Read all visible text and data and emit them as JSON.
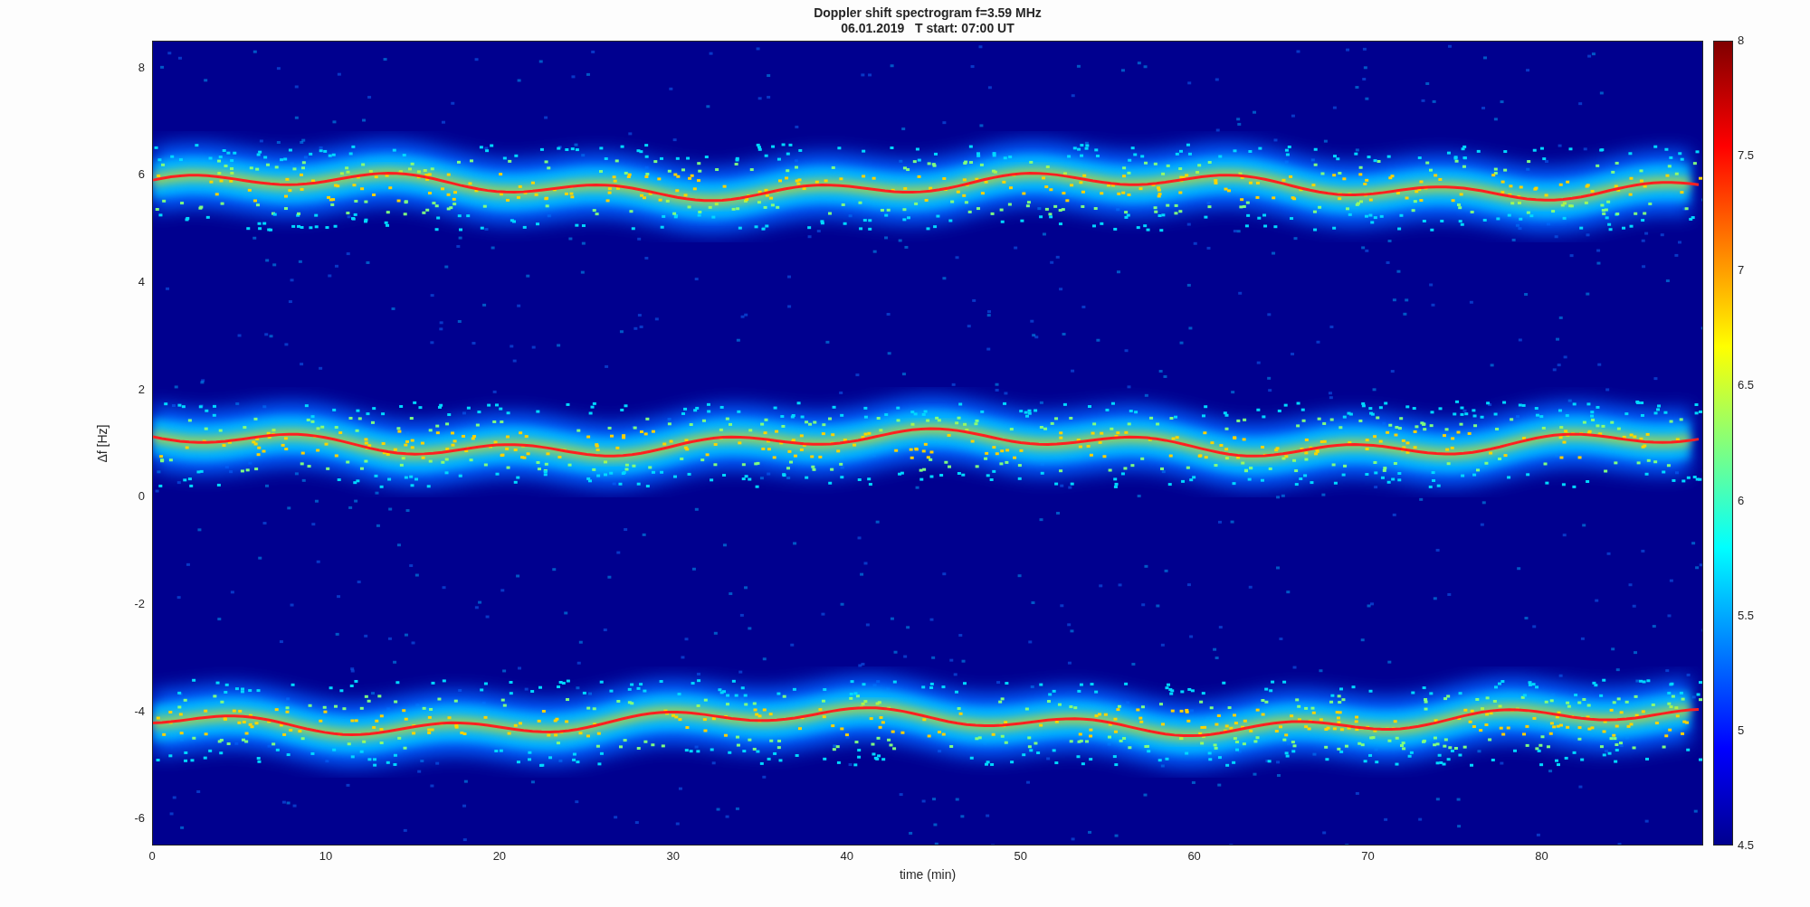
{
  "figure": {
    "title": "Doppler shift spectrogram f=3.59 MHz",
    "subtitle": "06.01.2019   T start: 07:00 UT"
  },
  "axes": {
    "ylabel": "Δf [Hz]",
    "xlabel": "time (min)",
    "yticks": [
      "8",
      "6",
      "4",
      "2",
      "0",
      "-2",
      "-4",
      "-6"
    ],
    "xticks": [
      "0",
      "10",
      "20",
      "30",
      "40",
      "50",
      "60",
      "70",
      "80"
    ]
  },
  "colorbar": {
    "ticks": [
      "8",
      "7.5",
      "7",
      "6.5",
      "6",
      "5.5",
      "5",
      "4.5"
    ]
  }
}
